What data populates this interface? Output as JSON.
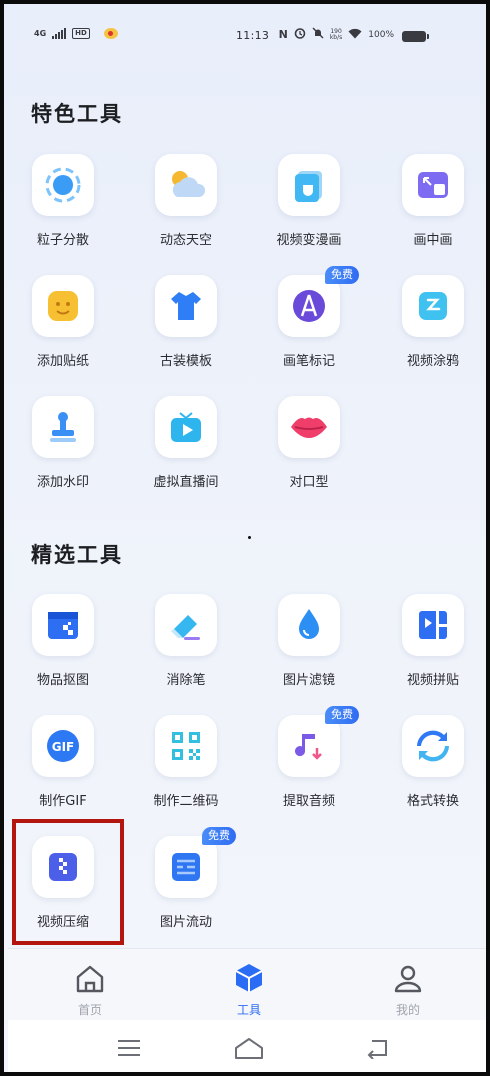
{
  "status_bar": {
    "network": "4G",
    "hd": "HD",
    "time": "11:13",
    "nfc_glyph": "N",
    "alarm_icon": "⏰",
    "mute_icon": "🔕",
    "net_speed_value": "190",
    "net_speed_unit": "kb/s",
    "wifi_icon": "wifi",
    "battery": "100%"
  },
  "sections": {
    "featured": {
      "title": "特色工具",
      "tools": [
        {
          "label": "粒子分散",
          "icon": "particle-icon"
        },
        {
          "label": "动态天空",
          "icon": "sky-icon"
        },
        {
          "label": "视频变漫画",
          "icon": "comic-icon"
        },
        {
          "label": "画中画",
          "icon": "pip-icon"
        },
        {
          "label": "添加贴纸",
          "icon": "sticker-icon"
        },
        {
          "label": "古装模板",
          "icon": "costume-icon"
        },
        {
          "label": "画笔标记",
          "icon": "brush-icon",
          "badge": "免费"
        },
        {
          "label": "视频涂鸦",
          "icon": "doodle-icon"
        },
        {
          "label": "添加水印",
          "icon": "watermark-icon"
        },
        {
          "label": "虚拟直播间",
          "icon": "live-icon"
        },
        {
          "label": "对口型",
          "icon": "lips-icon"
        }
      ]
    },
    "selected": {
      "title": "精选工具",
      "tools": [
        {
          "label": "物品抠图",
          "icon": "cutout-icon"
        },
        {
          "label": "消除笔",
          "icon": "eraser-icon"
        },
        {
          "label": "图片滤镜",
          "icon": "filter-icon"
        },
        {
          "label": "视频拼贴",
          "icon": "collage-icon"
        },
        {
          "label": "制作GIF",
          "icon": "gif-icon"
        },
        {
          "label": "制作二维码",
          "icon": "qrcode-icon"
        },
        {
          "label": "提取音频",
          "icon": "audio-icon",
          "badge": "免费"
        },
        {
          "label": "格式转换",
          "icon": "convert-icon"
        },
        {
          "label": "视频压缩",
          "icon": "compress-icon"
        },
        {
          "label": "图片流动",
          "icon": "flow-icon",
          "badge": "免费"
        }
      ]
    }
  },
  "gif_icon_text": "GIF",
  "bottom_nav": {
    "items": [
      {
        "label": "首页",
        "icon": "home-icon"
      },
      {
        "label": "工具",
        "icon": "cube-icon",
        "active": true
      },
      {
        "label": "我的",
        "icon": "profile-icon"
      }
    ]
  },
  "system_nav": [
    "menu-icon",
    "home-outline-icon",
    "back-icon"
  ],
  "colors": {
    "accent": "#2f6cf2",
    "highlight_box": "#b3150f",
    "badge": "#3d7cf5",
    "inactive": "#a0a4ad"
  }
}
